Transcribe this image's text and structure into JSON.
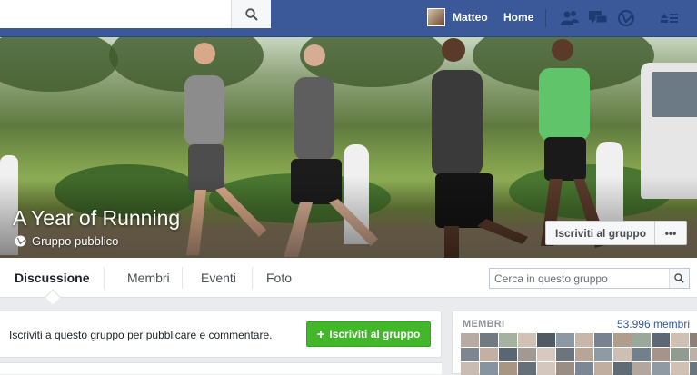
{
  "topbar": {
    "search_placeholder": "",
    "user_name": "Matteo",
    "home_label": "Home"
  },
  "cover": {
    "title": "A Year of Running",
    "privacy": "Gruppo pubblico",
    "join_button": "Iscriviti al gruppo",
    "more_button": "•••"
  },
  "nav": {
    "tabs": [
      "Discussione",
      "Membri",
      "Eventi",
      "Foto"
    ],
    "search_placeholder": "Cerca in questo gruppo"
  },
  "invite": {
    "text": "Iscriviti a questo gruppo per pubblicare e commentare.",
    "button": "Iscriviti al gruppo"
  },
  "members": {
    "label": "MEMBRI",
    "count": "53.996 membri"
  },
  "colors": {
    "brand": "#3b5998",
    "green": "#42b72a",
    "link": "#365899"
  }
}
